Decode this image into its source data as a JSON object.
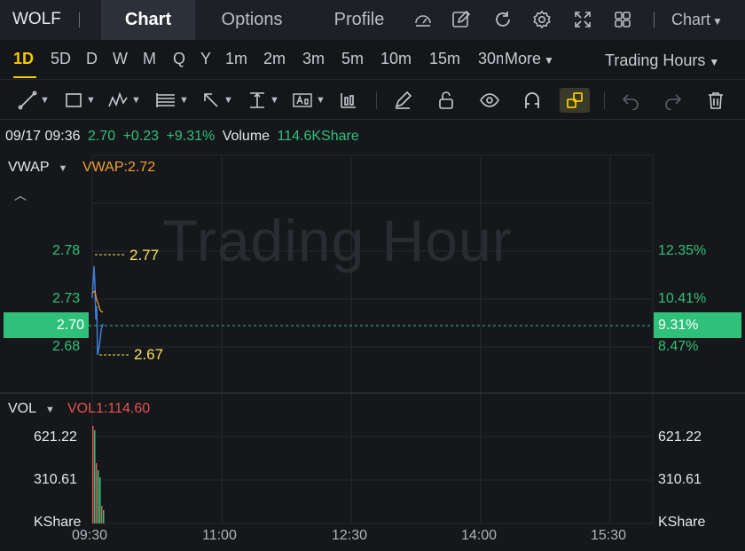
{
  "header": {
    "ticker": "WOLF",
    "tabs": [
      {
        "label": "Chart",
        "active": true
      },
      {
        "label": "Options",
        "active": false
      },
      {
        "label": "Profile",
        "active": false
      }
    ],
    "icons": [
      "gauge-icon",
      "edit-icon",
      "refresh-icon",
      "settings-icon",
      "fullscreen-icon",
      "grid-icon"
    ],
    "chart_menu": "Chart"
  },
  "periods": {
    "items": [
      "1D",
      "5D",
      "D",
      "W",
      "M",
      "Q",
      "Y",
      "1m",
      "2m",
      "3m",
      "5m",
      "10m",
      "15m",
      "30m"
    ],
    "more": "More",
    "active": "1D",
    "trading_hours": "Trading Hours"
  },
  "info": {
    "datetime": "09/17 09:36",
    "price": "2.70",
    "change": "+0.23",
    "change_pct": "+9.31%",
    "volume_label": "Volume",
    "volume_value": "114.6KShare"
  },
  "price_pane": {
    "indicator": "VWAP",
    "indicator_value": "VWAP:2.72",
    "watermark": "Trading Hour",
    "y_left": [
      "2.78",
      "2.73",
      "2.68"
    ],
    "y_right": [
      "12.35%",
      "10.41%",
      "8.47%"
    ],
    "current_price": "2.70",
    "current_pct": "9.31%",
    "high_label": "2.77",
    "low_label": "2.67"
  },
  "volume_pane": {
    "indicator": "VOL",
    "indicator_value": "VOL1:114.60",
    "y_left": [
      "621.22",
      "310.61",
      "KShare"
    ],
    "y_right": [
      "621.22",
      "310.61",
      "KShare"
    ]
  },
  "x_axis": [
    "09:30",
    "11:00",
    "12:30",
    "14:00",
    "15:30"
  ],
  "colors": {
    "up": "#2fc07a",
    "down": "#e0544f",
    "accent": "#f5c800",
    "vwap": "#f0a030",
    "price_line": "#3d7fd9"
  },
  "chart_data": {
    "type": "line",
    "price": {
      "min": 2.67,
      "max": 2.77,
      "last": 2.7,
      "vwap": 2.72
    },
    "volume_max_kshare": 621.22
  }
}
